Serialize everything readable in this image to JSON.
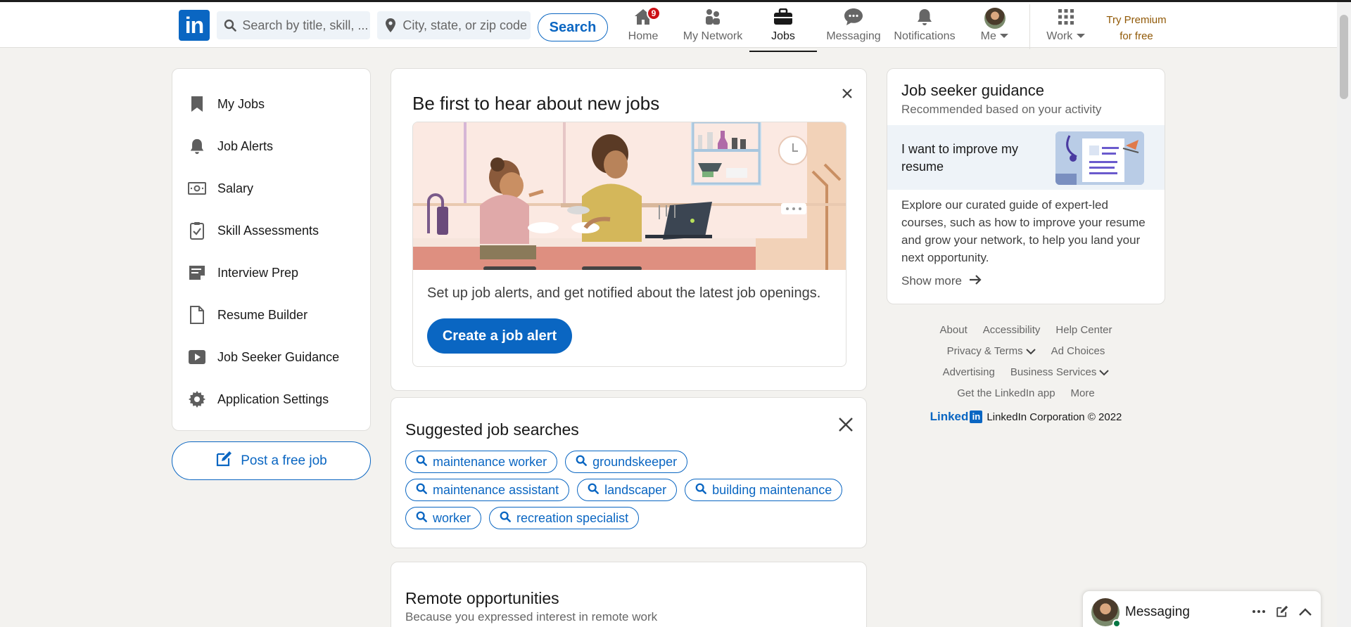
{
  "topbar": {
    "logo": "in",
    "search": {
      "keyword_placeholder": "Search by title, skill, ...",
      "location_placeholder": "City, state, or zip code",
      "button": "Search"
    },
    "nav": [
      {
        "label": "Home",
        "icon": "home-icon",
        "badge": "9"
      },
      {
        "label": "My Network",
        "icon": "network-icon"
      },
      {
        "label": "Jobs",
        "icon": "briefcase-icon",
        "active": true
      },
      {
        "label": "Messaging",
        "icon": "messaging-icon"
      },
      {
        "label": "Notifications",
        "icon": "bell-icon"
      },
      {
        "label": "Me",
        "icon": "avatar"
      },
      {
        "label": "Work",
        "icon": "grid-icon"
      }
    ],
    "premium": {
      "line1": "Try Premium",
      "line2": "for free"
    }
  },
  "sidebar": {
    "items": [
      {
        "label": "My Jobs",
        "icon": "bookmark-icon"
      },
      {
        "label": "Job Alerts",
        "icon": "bell-icon"
      },
      {
        "label": "Salary",
        "icon": "money-icon"
      },
      {
        "label": "Skill Assessments",
        "icon": "clipboard-check-icon"
      },
      {
        "label": "Interview Prep",
        "icon": "notepad-icon"
      },
      {
        "label": "Resume Builder",
        "icon": "document-icon"
      },
      {
        "label": "Job Seeker Guidance",
        "icon": "play-icon"
      },
      {
        "label": "Application Settings",
        "icon": "gear-icon"
      }
    ],
    "post_job": "Post a free job"
  },
  "alert_card": {
    "title": "Be first to hear about new jobs",
    "text": "Set up job alerts, and get notified about the latest job openings.",
    "button": "Create a job alert"
  },
  "suggested": {
    "title": "Suggested job searches",
    "pills": [
      "maintenance worker",
      "groundskeeper",
      "maintenance assistant",
      "landscaper",
      "building maintenance",
      "worker",
      "recreation specialist"
    ]
  },
  "remote": {
    "title": "Remote opportunities",
    "subtitle": "Because you expressed interest in remote work"
  },
  "guidance": {
    "title": "Job seeker guidance",
    "subtitle": "Recommended based on your activity",
    "band_text": "I want to improve my resume",
    "body": "Explore our curated guide of expert-led courses, such as how to improve your resume and grow your network, to help you land your next opportunity.",
    "show_more": "Show more"
  },
  "footer": {
    "row1": [
      "About",
      "Accessibility",
      "Help Center"
    ],
    "row2": [
      "Privacy & Terms",
      "Ad Choices"
    ],
    "row3": [
      "Advertising",
      "Business Services"
    ],
    "row4": [
      "Get the LinkedIn app",
      "More"
    ],
    "brand": "Linked",
    "brand_in": "in",
    "copyright": "LinkedIn Corporation © 2022"
  },
  "messaging": {
    "label": "Messaging"
  },
  "colors": {
    "brand": "#0a66c2",
    "premium": "#915907",
    "badge": "#cc1016",
    "background": "#f3f2ef"
  }
}
